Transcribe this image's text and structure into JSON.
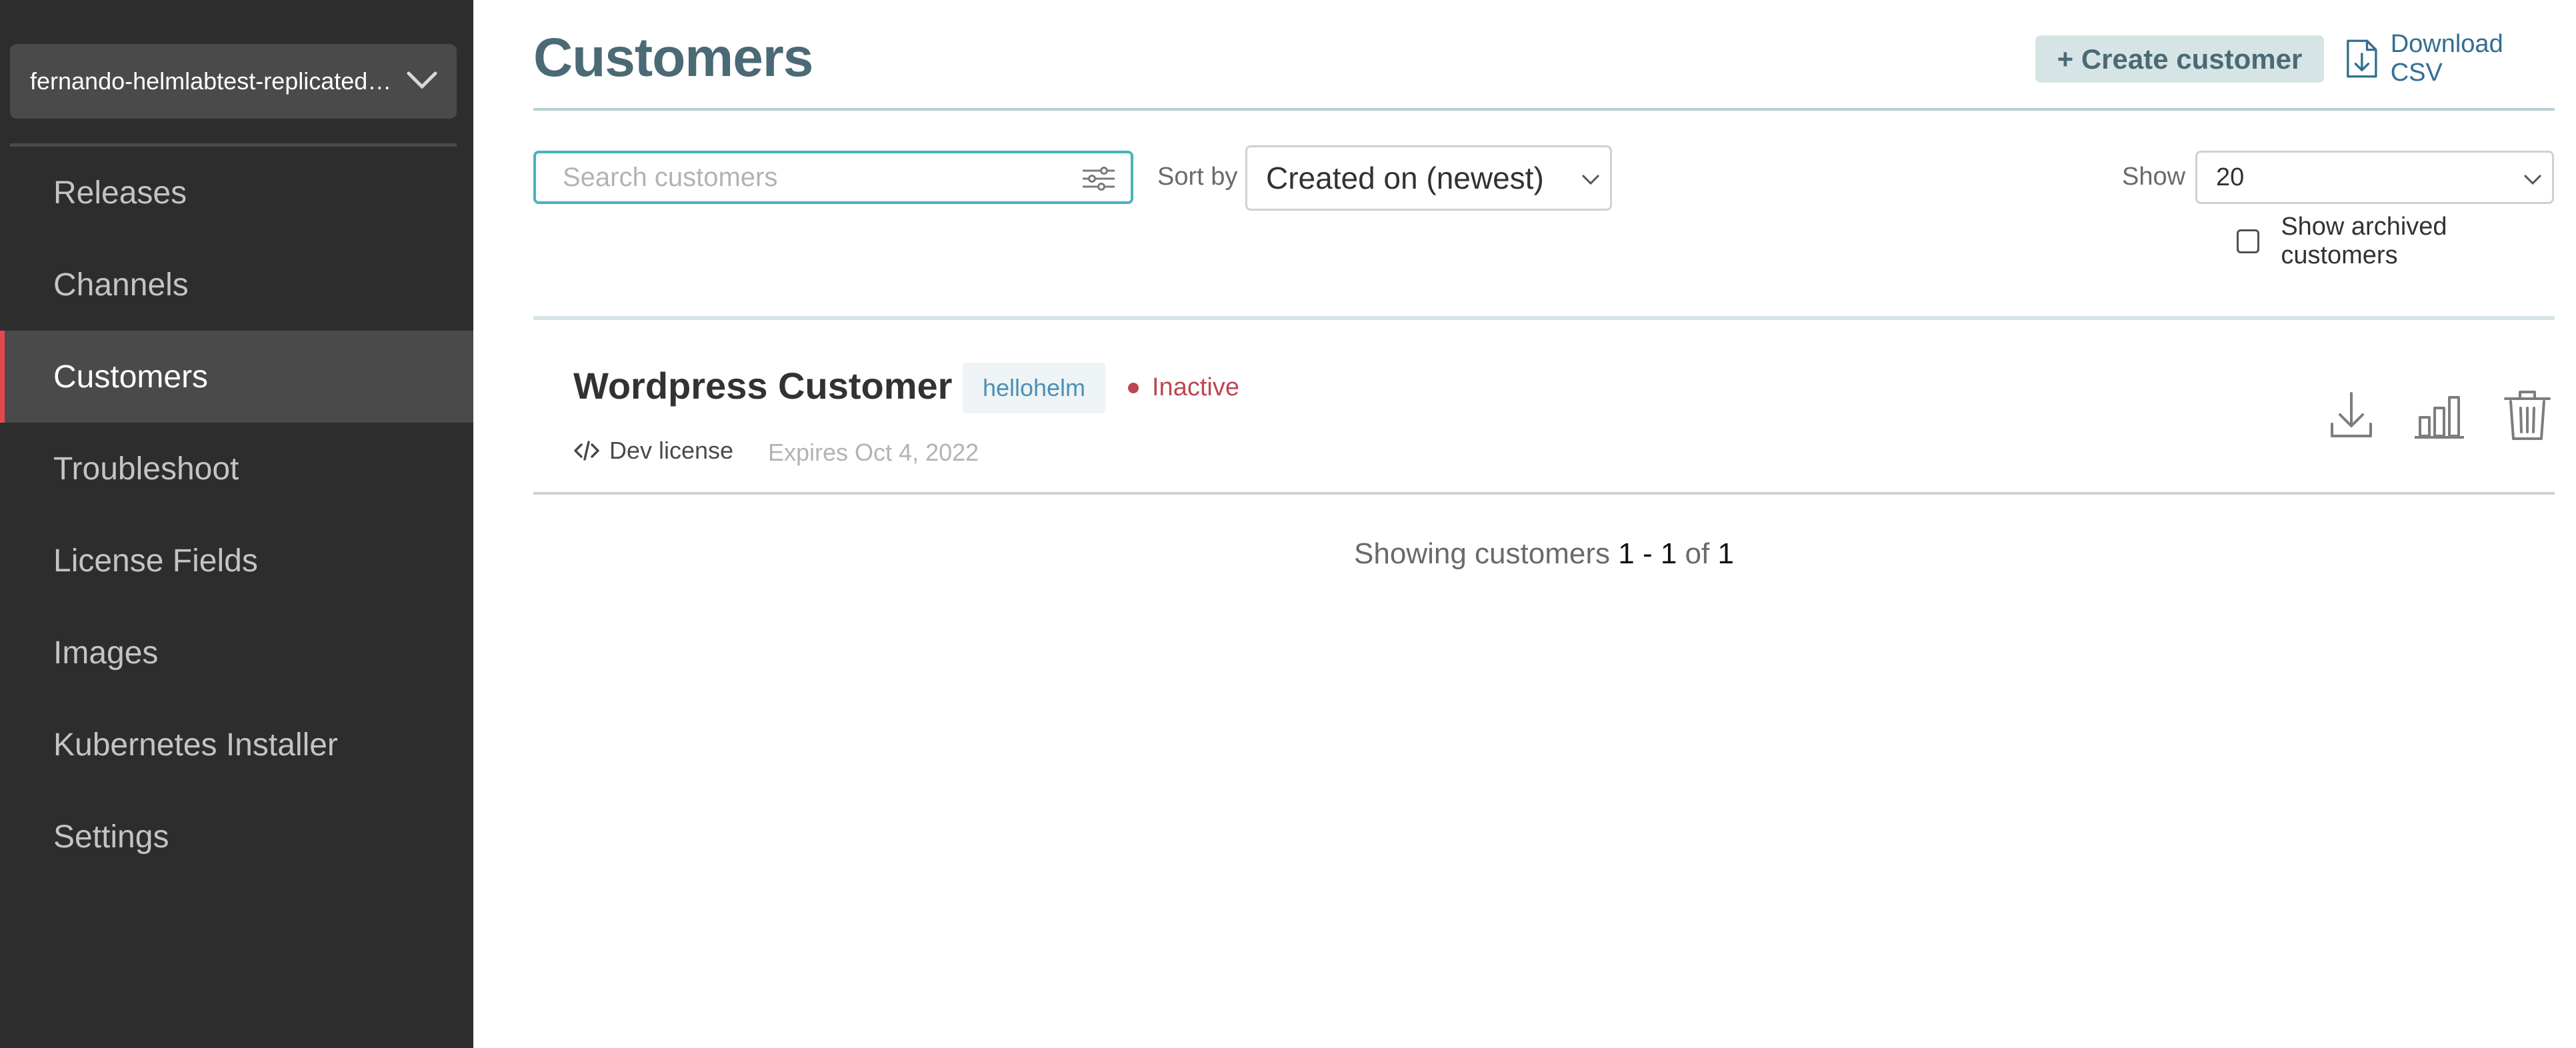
{
  "sidebar": {
    "app_name": "fernando-helmlabtest-replicated…",
    "items": [
      {
        "label": "Releases",
        "active": false
      },
      {
        "label": "Channels",
        "active": false
      },
      {
        "label": "Customers",
        "active": true
      },
      {
        "label": "Troubleshoot",
        "active": false
      },
      {
        "label": "License Fields",
        "active": false
      },
      {
        "label": "Images",
        "active": false
      },
      {
        "label": "Kubernetes Installer",
        "active": false
      },
      {
        "label": "Settings",
        "active": false
      }
    ]
  },
  "header": {
    "title": "Customers",
    "create_label": "+ Create customer",
    "download_label": "Download CSV"
  },
  "toolbar": {
    "search_placeholder": "Search customers",
    "search_value": "",
    "sort_label": "Sort by",
    "sort_value": "Created on (newest)",
    "show_label": "Show",
    "show_value": "20",
    "archived_label": "Show archived customers",
    "archived_checked": false
  },
  "customers": [
    {
      "name": "Wordpress Customer",
      "channel": "hellohelm",
      "status": "Inactive",
      "license_type": "Dev license",
      "expires": "Expires Oct 4, 2022"
    }
  ],
  "pagination": {
    "prefix": "Showing customers",
    "start": "1",
    "dash": "-",
    "end": "1",
    "of": "of",
    "total": "1"
  },
  "colors": {
    "sidebar_bg": "#2d2d2d",
    "active_marker": "#e4484f",
    "title": "#4a6a75",
    "link": "#326e91",
    "status_inactive": "#bc4752",
    "search_border": "#49b3bd"
  }
}
